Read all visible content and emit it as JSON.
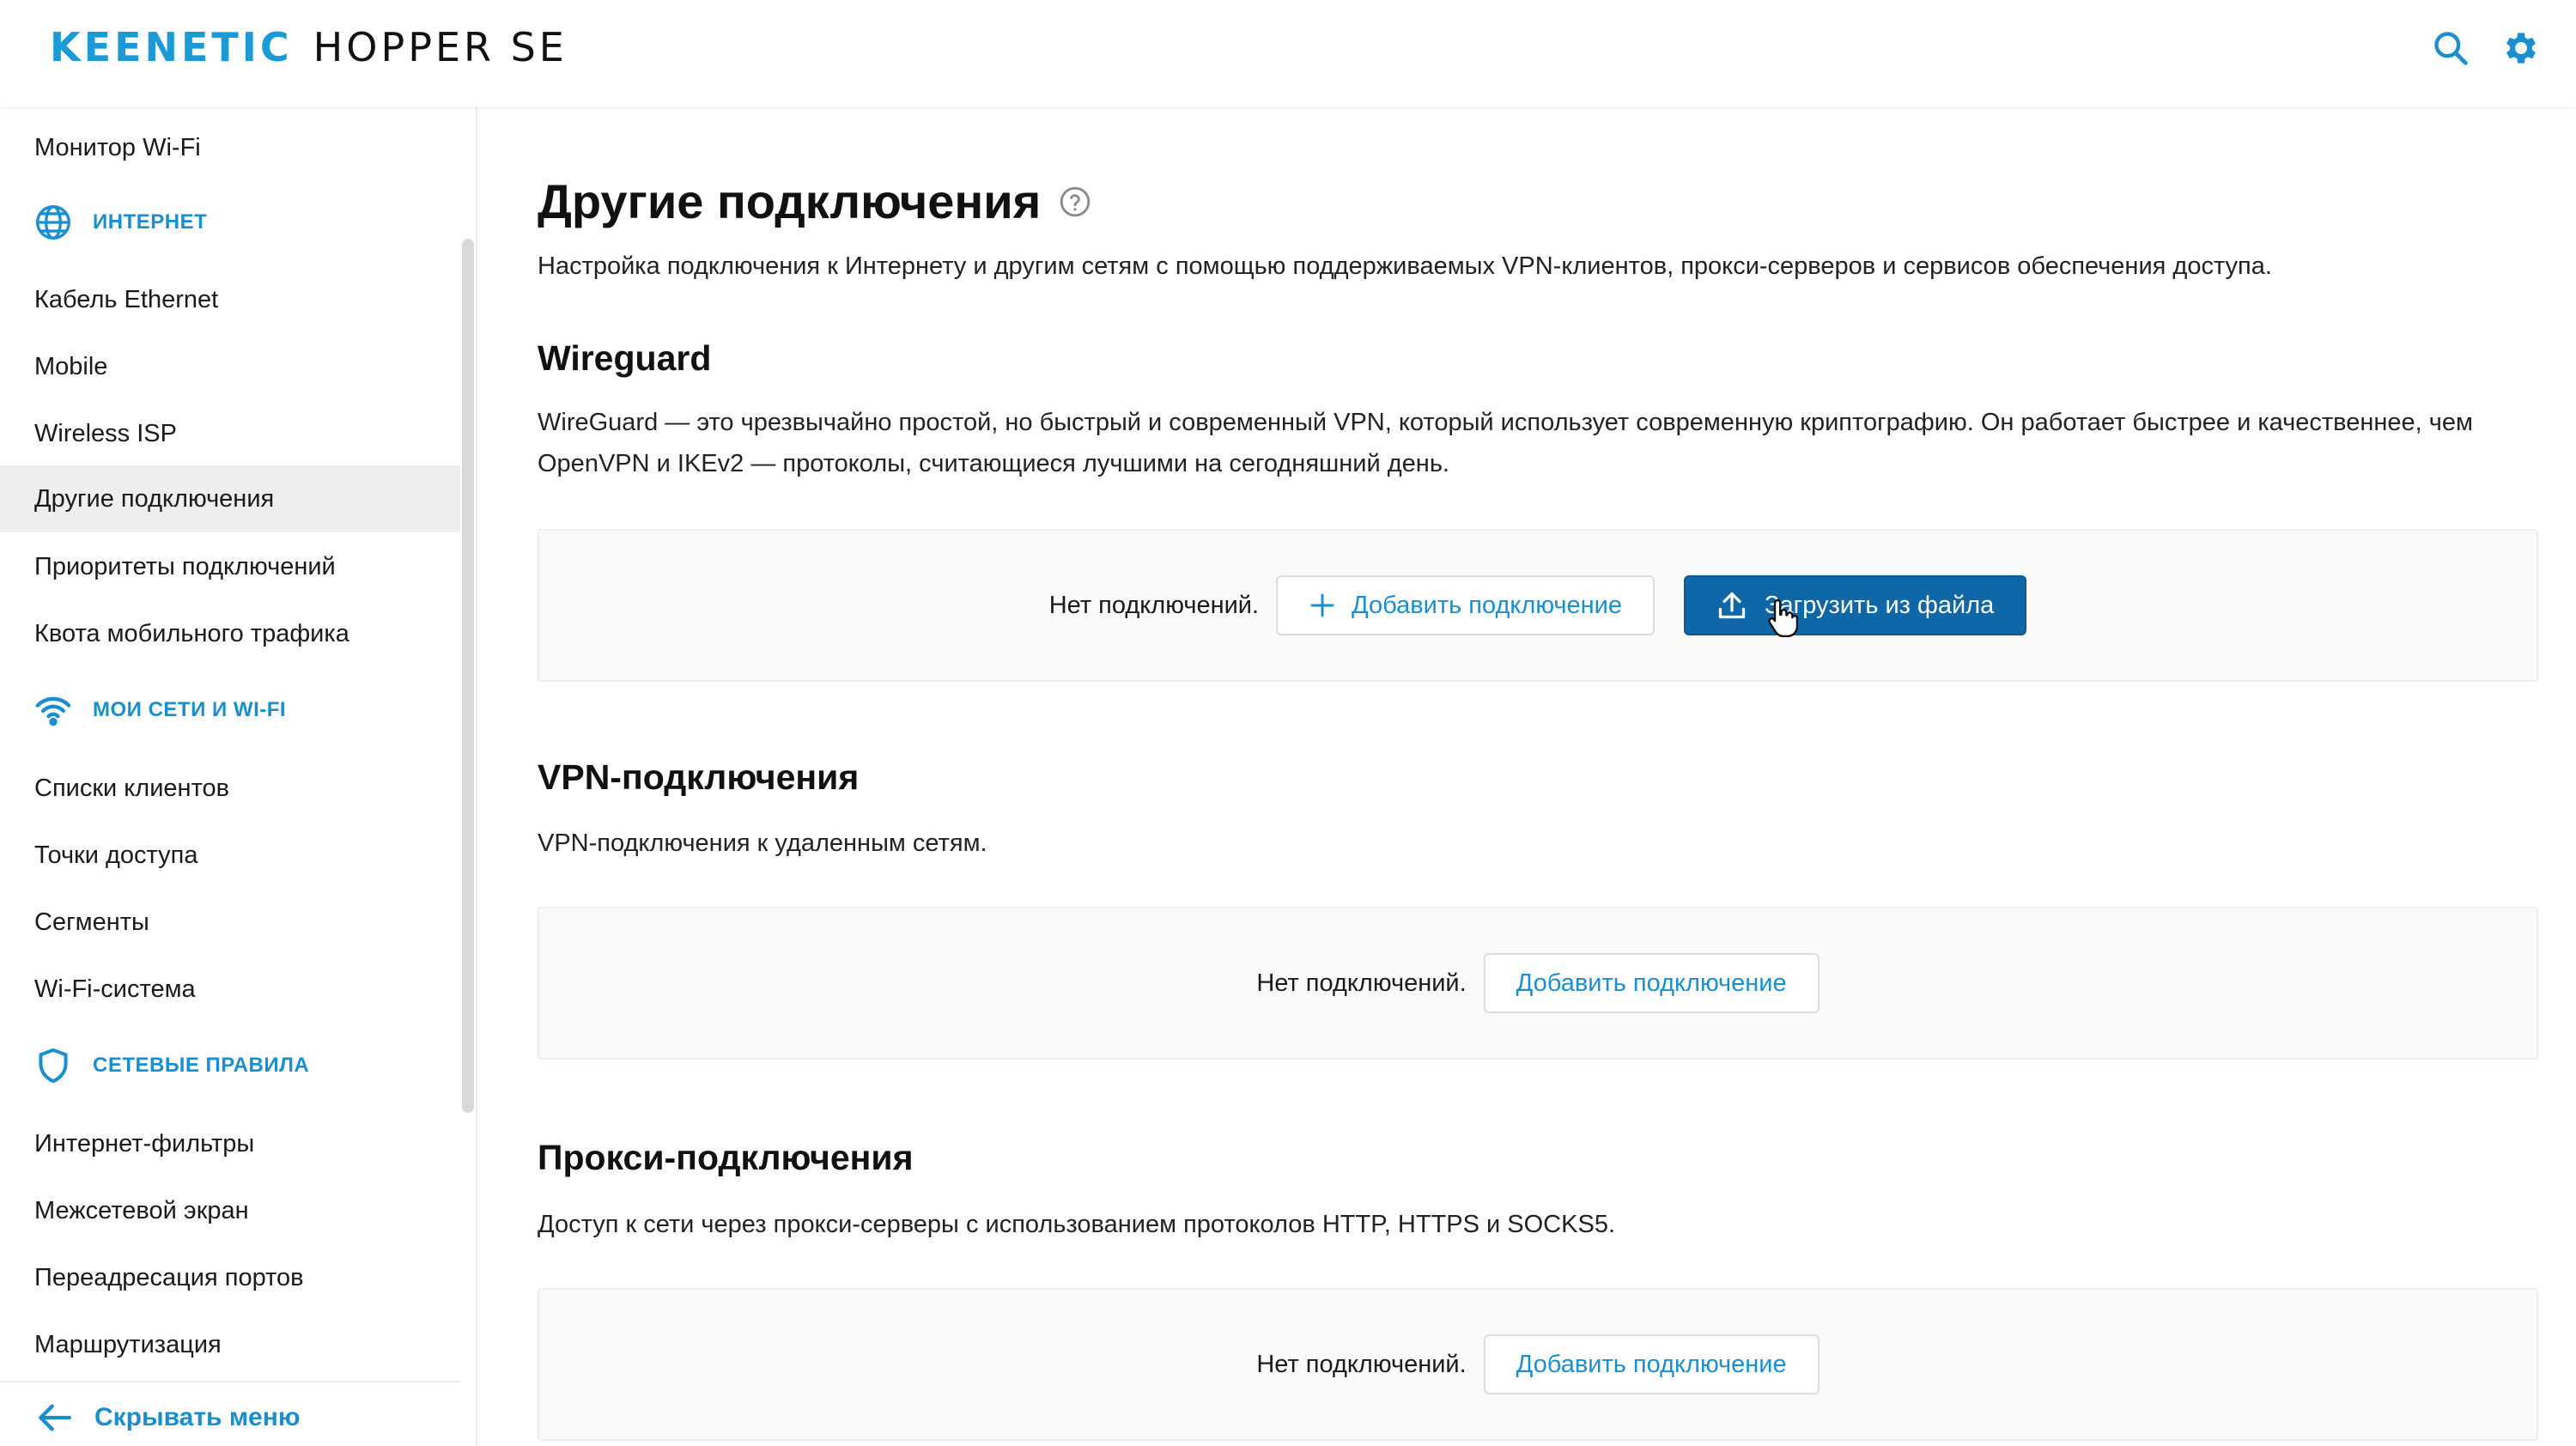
{
  "header": {
    "brand_name": "KEENETIC",
    "brand_model": "HOPPER SE",
    "icons": [
      "search-icon",
      "gear-icon"
    ],
    "accent_color": "#1a9ad6"
  },
  "sidebar": {
    "items": [
      {
        "label": "Монитор Wi-Fi"
      },
      {
        "section": "ИНТЕРНЕТ",
        "icon": "globe-icon"
      },
      {
        "label": "Кабель Ethernet"
      },
      {
        "label": "Mobile"
      },
      {
        "label": "Wireless ISP"
      },
      {
        "label": "Другие подключения",
        "active": true
      },
      {
        "label": "Приоритеты подключений"
      },
      {
        "label": "Квота мобильного трафика"
      },
      {
        "section": "МОИ СЕТИ И WI-FI",
        "icon": "wifi-icon"
      },
      {
        "label": "Списки клиентов"
      },
      {
        "label": "Точки доступа"
      },
      {
        "label": "Сегменты"
      },
      {
        "label": "Wi-Fi-система"
      },
      {
        "section": "СЕТЕВЫЕ ПРАВИЛА",
        "icon": "shield-icon"
      },
      {
        "label": "Интернет-фильтры"
      },
      {
        "label": "Межсетевой экран"
      },
      {
        "label": "Переадресация портов"
      },
      {
        "label": "Маршрутизация"
      }
    ],
    "hide_menu_label": "Скрывать меню"
  },
  "main": {
    "title": "Другие подключения",
    "description": "Настройка подключения к Интернету и другим сетям с помощью поддерживаемых VPN-клиентов, прокси-серверов и сервисов обеспечения доступа.",
    "sections": [
      {
        "title": "Wireguard",
        "description": "WireGuard — это чрезвычайно простой, но быстрый и современный VPN, который использует современную криптографию. Он работает быстрее и качественнее, чем OpenVPN и IKEv2 — протоколы, считающиеся лучшими на сегодняшний день.",
        "empty_text": "Нет подключений.",
        "add_label": "Добавить подключение",
        "upload_label": "Загрузить из файла"
      },
      {
        "title": "VPN-подключения",
        "description": "VPN-подключения к удаленным сетям.",
        "empty_text": "Нет подключений.",
        "add_label": "Добавить подключение"
      },
      {
        "title": "Прокси-подключения",
        "description": "Доступ к сети через прокси-серверы с использованием протоколов HTTP, HTTPS и SOCKS5.",
        "empty_text": "Нет подключений.",
        "add_label": "Добавить подключение"
      }
    ]
  }
}
